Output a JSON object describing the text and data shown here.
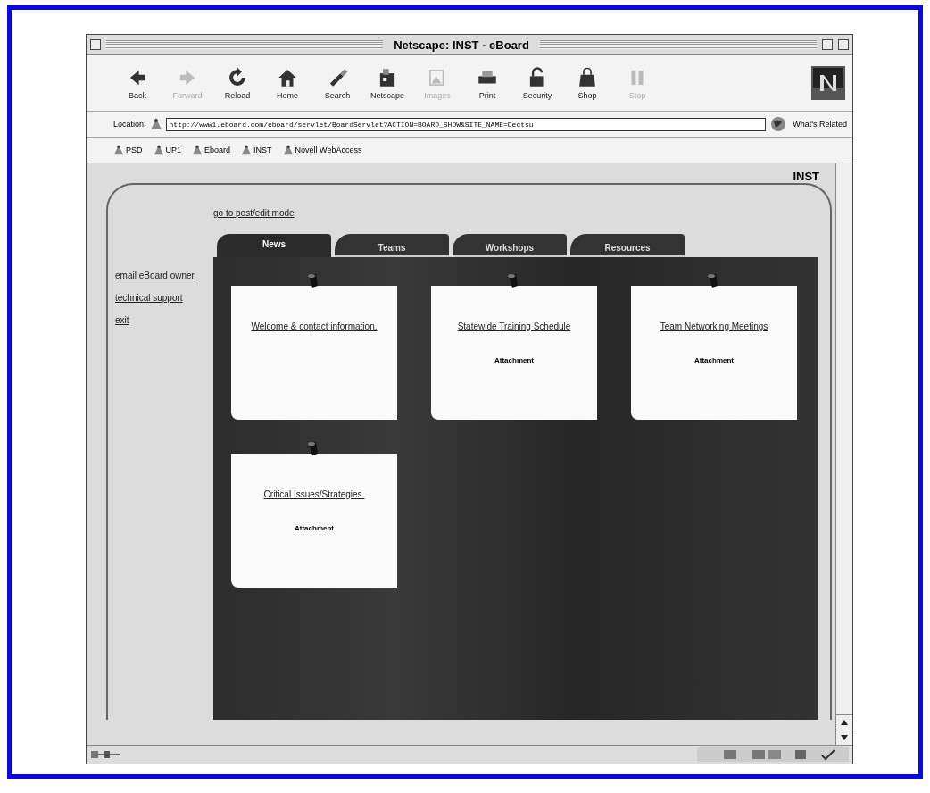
{
  "window": {
    "title": "Netscape: INST - eBoard"
  },
  "toolbar": [
    {
      "label": "Back",
      "disabled": false
    },
    {
      "label": "Forward",
      "disabled": true
    },
    {
      "label": "Reload",
      "disabled": false
    },
    {
      "label": "Home",
      "disabled": false
    },
    {
      "label": "Search",
      "disabled": false
    },
    {
      "label": "Netscape",
      "disabled": false
    },
    {
      "label": "Images",
      "disabled": true
    },
    {
      "label": "Print",
      "disabled": false
    },
    {
      "label": "Security",
      "disabled": false
    },
    {
      "label": "Shop",
      "disabled": false
    },
    {
      "label": "Stop",
      "disabled": true
    }
  ],
  "location": {
    "label": "Location:",
    "value": "http://www1.eboard.com/eboard/servlet/BoardServlet?ACTION=BOARD_SHOW&SITE_NAME=Dectsu",
    "related": "What's Related"
  },
  "bookmarks": [
    "PSD",
    "UP1",
    "Eboard",
    "INST",
    "Novell WebAccess"
  ],
  "page": {
    "site": "INST",
    "edit_link": "go to post/edit mode",
    "side_links": [
      "email eBoard owner",
      "technical support",
      "exit"
    ],
    "tabs": [
      {
        "label": "News",
        "selected": true
      },
      {
        "label": "Teams",
        "selected": false
      },
      {
        "label": "Workshops",
        "selected": false
      },
      {
        "label": "Resources",
        "selected": false
      }
    ],
    "notes": [
      {
        "title": "Welcome & contact information."
      },
      {
        "title": "Statewide Training Schedule",
        "attachment": "Attachment"
      },
      {
        "title": "Team Networking Meetings",
        "attachment": "Attachment"
      },
      {
        "title": "Critical Issues/Strategies.",
        "attachment": "Attachment"
      }
    ]
  }
}
